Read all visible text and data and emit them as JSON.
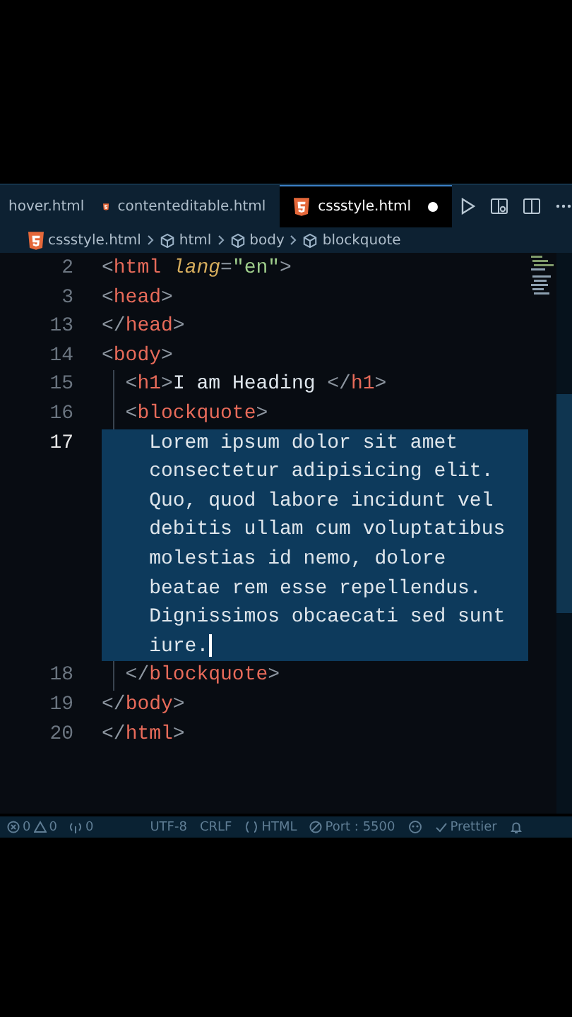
{
  "tabs": [
    {
      "label": "hover.html",
      "icon": false,
      "selected": false,
      "modified": false
    },
    {
      "label": "contenteditable.html",
      "icon": true,
      "selected": false,
      "modified": false
    },
    {
      "label": "cssstyle.html",
      "icon": true,
      "selected": true,
      "modified": true
    }
  ],
  "breadcrumb": [
    {
      "label": "cssstyle.html",
      "kind": "file"
    },
    {
      "label": "html",
      "kind": "element"
    },
    {
      "label": "body",
      "kind": "element"
    },
    {
      "label": "blockquote",
      "kind": "element"
    }
  ],
  "lines": [
    {
      "number": "2",
      "selected": false,
      "tokens": [
        {
          "kind": "punct",
          "text": "<"
        },
        {
          "kind": "tag",
          "text": "html"
        },
        {
          "kind": "attr",
          "text": " lang"
        },
        {
          "kind": "punct",
          "text": "="
        },
        {
          "kind": "string",
          "text": "\"en\""
        },
        {
          "kind": "punct",
          "text": ">"
        }
      ]
    },
    {
      "number": "3",
      "selected": false,
      "tokens": [
        {
          "kind": "punct",
          "text": "<"
        },
        {
          "kind": "tag",
          "text": "head"
        },
        {
          "kind": "punct",
          "text": ">"
        }
      ]
    },
    {
      "number": "13",
      "selected": false,
      "tokens": [
        {
          "kind": "punct",
          "text": "</"
        },
        {
          "kind": "tag",
          "text": "head"
        },
        {
          "kind": "punct",
          "text": ">"
        }
      ]
    },
    {
      "number": "14",
      "selected": false,
      "tokens": [
        {
          "kind": "punct",
          "text": "<"
        },
        {
          "kind": "tag",
          "text": "body"
        },
        {
          "kind": "punct",
          "text": ">"
        }
      ]
    },
    {
      "number": "15",
      "selected": false,
      "tokens": [
        {
          "kind": "punct",
          "text": "  <"
        },
        {
          "kind": "tag",
          "text": "h1"
        },
        {
          "kind": "punct",
          "text": ">"
        },
        {
          "kind": "text",
          "text": "I am Heading "
        },
        {
          "kind": "punct",
          "text": "</"
        },
        {
          "kind": "tag",
          "text": "h1"
        },
        {
          "kind": "punct",
          "text": ">"
        }
      ]
    },
    {
      "number": "16",
      "selected": false,
      "tokens": [
        {
          "kind": "punct",
          "text": "  <"
        },
        {
          "kind": "tag",
          "text": "blockquote"
        },
        {
          "kind": "punct",
          "text": ">"
        }
      ]
    },
    {
      "number": "17",
      "selected": true,
      "tokens": [
        {
          "kind": "text",
          "text": "    Lorem ipsum dolor sit amet consectetur adipisicing elit. Quo, quod labore incidunt vel debitis ullam cum voluptatibus molestias id nemo, dolore beatae rem esse repellendus. Dignissimos obcaecati sed sunt iure."
        }
      ]
    },
    {
      "number": "18",
      "selected": false,
      "tokens": [
        {
          "kind": "punct",
          "text": "  </"
        },
        {
          "kind": "tag",
          "text": "blockquote"
        },
        {
          "kind": "punct",
          "text": ">"
        }
      ]
    },
    {
      "number": "19",
      "selected": false,
      "tokens": [
        {
          "kind": "punct",
          "text": "</"
        },
        {
          "kind": "tag",
          "text": "body"
        },
        {
          "kind": "punct",
          "text": ">"
        }
      ]
    },
    {
      "number": "20",
      "selected": false,
      "tokens": [
        {
          "kind": "punct",
          "text": "</"
        },
        {
          "kind": "tag",
          "text": "html"
        },
        {
          "kind": "punct",
          "text": ">"
        }
      ]
    }
  ],
  "status_bar": {
    "errors": "0",
    "warnings": "0",
    "ports": "0",
    "encoding": "UTF-8",
    "eol": "CRLF",
    "language": "HTML",
    "server": "Port : 5500",
    "formatter": "Prettier"
  }
}
